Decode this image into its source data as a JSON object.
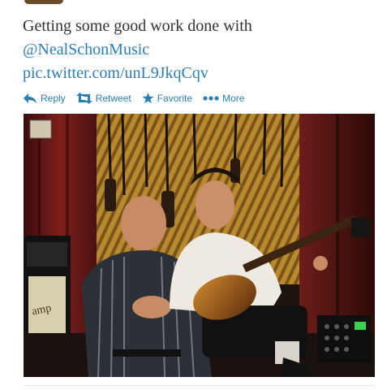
{
  "tweet": {
    "text_line1": "Getting some good work done with",
    "mention": "@NealSchonMusic",
    "pic_link": "pic.twitter.com/unL9JkqCqv"
  },
  "actions": {
    "reply": "Reply",
    "retweet": "Retweet",
    "favorite": "Favorite",
    "more": "More"
  },
  "icons": {
    "reply": "reply-arrow-icon",
    "retweet": "retweet-icon",
    "favorite": "star-icon",
    "more": "ellipsis-icon"
  },
  "colors": {
    "text": "#333333",
    "link": "#2a7fb8"
  }
}
